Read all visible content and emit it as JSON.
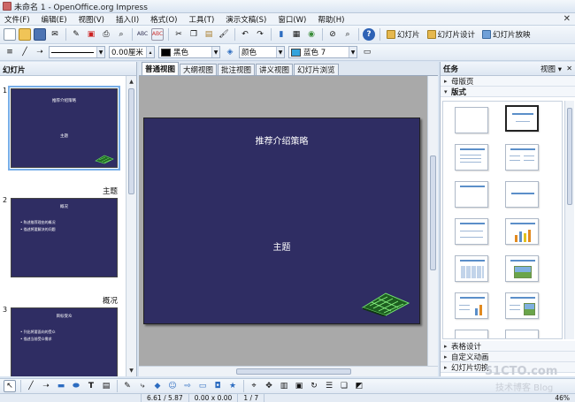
{
  "window": {
    "title": "未命名 1 - OpenOffice.org Impress"
  },
  "menu": [
    "文件(F)",
    "编辑(E)",
    "视图(V)",
    "插入(I)",
    "格式(O)",
    "工具(T)",
    "演示文稿(S)",
    "窗口(W)",
    "帮助(H)"
  ],
  "toolbar1": {
    "slide_label": "幻灯片",
    "design_label": "幻灯片设计",
    "show_label": "幻灯片放映"
  },
  "toolbar2": {
    "line_width": "0.00厘米",
    "line_color": {
      "label": "黑色",
      "color": "#000000"
    },
    "area_style": "颜色",
    "area_color": {
      "label": "蓝色 7",
      "color": "#33a3dc"
    }
  },
  "slide_panel": {
    "title": "幻灯片",
    "slides": [
      {
        "number": "1",
        "thumb_title": "推荐介绍策略",
        "thumb_subtitle": "主题",
        "caption": "主题",
        "bullets": []
      },
      {
        "number": "2",
        "thumb_title": "概况",
        "thumb_subtitle": "",
        "caption": "概况",
        "bullets": [
          "• 陈述推荐理由的概况",
          "• 描述将要解决的问题"
        ]
      },
      {
        "number": "3",
        "thumb_title": "目标受众",
        "thumb_subtitle": "",
        "caption": "",
        "bullets": [
          "• 列出将要面向的受众",
          "• 描述当前受众需求"
        ]
      }
    ]
  },
  "tabs": [
    "普通视图",
    "大纲视图",
    "批注视图",
    "讲义视图",
    "幻灯片浏览"
  ],
  "main_slide": {
    "title": "推荐介绍策略",
    "subtitle": "主题",
    "background": "#2f2d63"
  },
  "task_pane": {
    "title": "任务",
    "view_label": "视图",
    "sections_top": [
      "母版页",
      "版式"
    ],
    "sections_bottom": [
      "表格设计",
      "自定义动画",
      "幻灯片切换"
    ]
  },
  "status": {
    "position": "6.61 / 5.87",
    "size": "0.00 x 0.00",
    "page": "1 / 7",
    "zoom": "46%"
  },
  "watermark": {
    "line1": "51CTO.com",
    "line2": "技术博客  Blog"
  }
}
